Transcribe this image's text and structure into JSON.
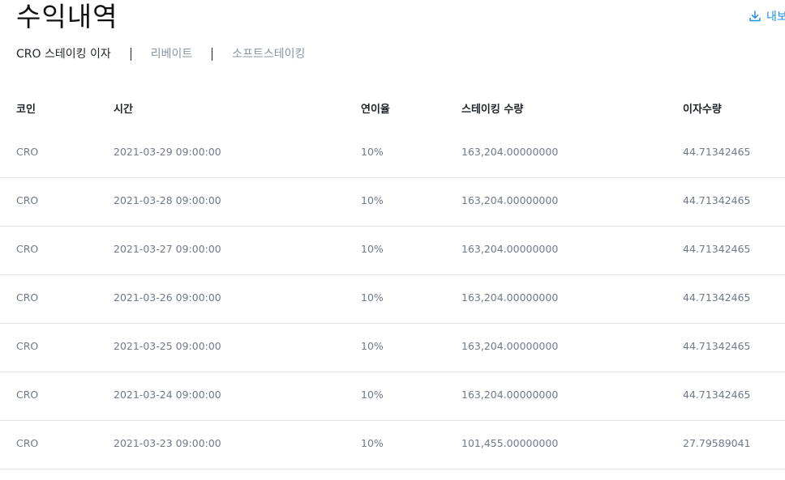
{
  "header": {
    "title": "수익내역",
    "export_label": "내보"
  },
  "tabs": [
    {
      "label": "CRO 스테이킹 이자",
      "active": true
    },
    {
      "label": "리베이트",
      "active": false
    },
    {
      "label": "소프트스테이킹",
      "active": false
    }
  ],
  "table": {
    "columns": [
      "코인",
      "시간",
      "연이율",
      "스테이킹 수량",
      "이자수량"
    ],
    "rows": [
      {
        "coin": "CRO",
        "time": "2021-03-29 09:00:00",
        "rate": "10%",
        "stake": "163,204.00000000",
        "interest": "44.71342465"
      },
      {
        "coin": "CRO",
        "time": "2021-03-28 09:00:00",
        "rate": "10%",
        "stake": "163,204.00000000",
        "interest": "44.71342465"
      },
      {
        "coin": "CRO",
        "time": "2021-03-27 09:00:00",
        "rate": "10%",
        "stake": "163,204.00000000",
        "interest": "44.71342465"
      },
      {
        "coin": "CRO",
        "time": "2021-03-26 09:00:00",
        "rate": "10%",
        "stake": "163,204.00000000",
        "interest": "44.71342465"
      },
      {
        "coin": "CRO",
        "time": "2021-03-25 09:00:00",
        "rate": "10%",
        "stake": "163,204.00000000",
        "interest": "44.71342465"
      },
      {
        "coin": "CRO",
        "time": "2021-03-24 09:00:00",
        "rate": "10%",
        "stake": "163,204.00000000",
        "interest": "44.71342465"
      },
      {
        "coin": "CRO",
        "time": "2021-03-23 09:00:00",
        "rate": "10%",
        "stake": "101,455.00000000",
        "interest": "27.79589041"
      }
    ]
  },
  "icons": {
    "export": "download-icon"
  },
  "colors": {
    "accent": "#1f8fe0",
    "text_primary": "#1e2329",
    "text_secondary": "#707a8a",
    "tab_inactive": "#8a95a3",
    "divider": "#e3e6ea"
  }
}
